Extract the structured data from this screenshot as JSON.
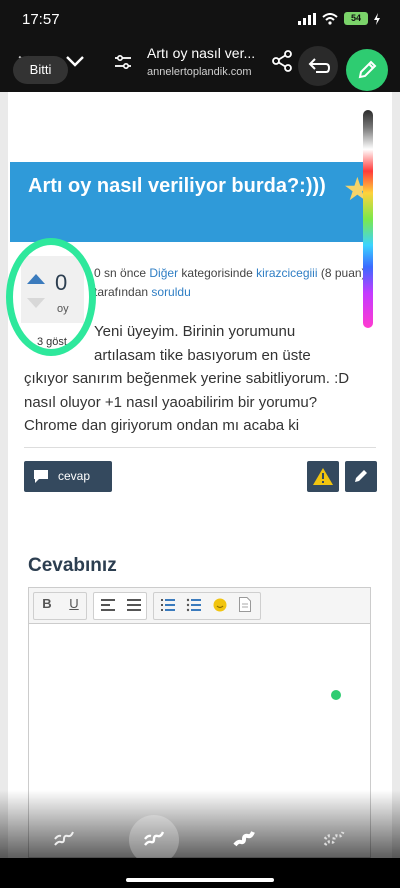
{
  "status_bar": {
    "time": "17:57",
    "battery": "54"
  },
  "toolbar": {
    "done_label": "Bitti",
    "page_title": "Artı oy nasıl ver...",
    "page_url": "annelertoplandik.com"
  },
  "question": {
    "title": "Artı oy nasıl veriliyor burda?:)))",
    "votes": "0",
    "votes_label": "oy",
    "views": "3 göst.",
    "meta": {
      "time": "0 sn önce",
      "category": "Diğer",
      "in_category": "kategorisinde",
      "user": "kirazcicegiii",
      "points": "(8 puan)",
      "by": "tarafından",
      "asked": "soruldu"
    },
    "body_lines": [
      "Yeni üyeyim. Birinin yorumunu",
      "artılasam tike basıyorum en üste",
      "çıkıyor sanırım beğenmek yerine sabitliyorum. :D",
      "nasıl oluyor +1 nasıl yaoabilirim bir yorumu?",
      "Chrome dan giriyorum ondan mı acaba ki"
    ]
  },
  "actions": {
    "answer_label": "cevap"
  },
  "answer": {
    "heading": "Cevabınız"
  },
  "editor": {
    "bold": "B",
    "underline": "U"
  },
  "colors": {
    "accent": "#2f9ad9",
    "dark_button": "#34495e",
    "highlight": "#2ee89c",
    "pen": "#2ecc71"
  },
  "icons": [
    "close-icon",
    "chevron-down-icon",
    "menu-icon",
    "share-icon",
    "undo-icon",
    "pen-icon",
    "star-icon",
    "chat-icon",
    "warning-icon",
    "edit-icon"
  ]
}
